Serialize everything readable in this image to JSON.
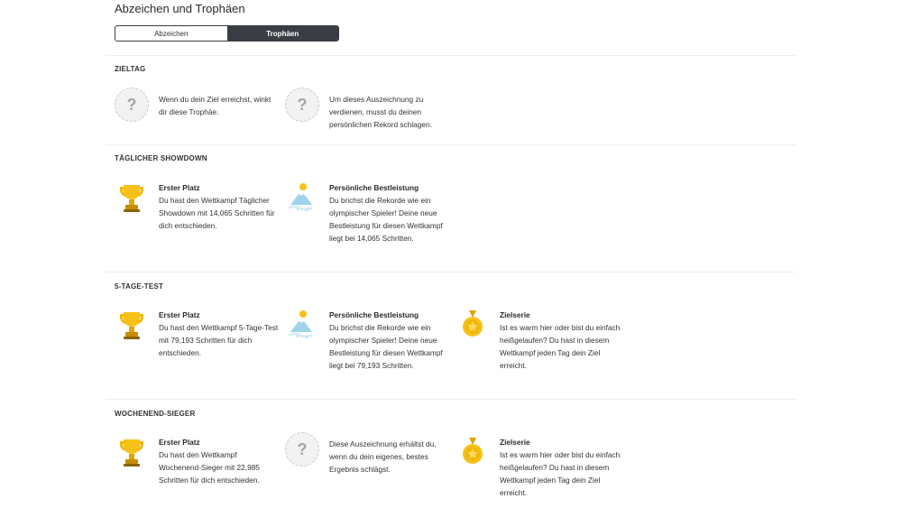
{
  "page": {
    "title": "Abzeichen und Trophäen"
  },
  "tabs": [
    {
      "label": "Abzeichen"
    },
    {
      "label": "Trophäen"
    }
  ],
  "sections": [
    {
      "title": "ZIELTAG",
      "items": [
        {
          "icon": "question-mark-icon",
          "title": "",
          "desc": "Wenn du dein Ziel erreichst, winkt dir diese Trophäe."
        },
        {
          "icon": "question-mark-icon",
          "title": "",
          "desc": "Um dieses Auszeichnung zu verdienen, musst du deinen persönlichen Rekord schlagen."
        }
      ]
    },
    {
      "title": "TÄGLICHER SHOWDOWN",
      "items": [
        {
          "icon": "trophy-icon",
          "title": "Erster Platz",
          "desc": "Du hast den Wettkampf Täglicher Showdown mit 14,065 Schritten für dich entschieden."
        },
        {
          "icon": "mountain-peak-icon",
          "title": "Persönliche Bestleistung",
          "desc": "Du brichst die Rekorde wie ein olympischer Spieler! Deine neue Bestleistung für diesen Wettkampf liegt bei 14,065 Schritten."
        }
      ]
    },
    {
      "title": "5-TAGE-TEST",
      "items": [
        {
          "icon": "trophy-icon",
          "title": "Erster Platz",
          "desc": "Du hast den Wettkampf 5-Tage-Test mit 79,193 Schritten für dich entschieden."
        },
        {
          "icon": "mountain-peak-icon",
          "title": "Persönliche Bestleistung",
          "desc": "Du brichst die Rekorde wie ein olympischer Spieler! Deine neue Bestleistung für diesen Wettkampf liegt bei 79,193 Schritten."
        },
        {
          "icon": "medal-icon",
          "title": "Zielserie",
          "desc": "Ist es warm hier oder bist du einfach heißgelaufen? Du hast in diesem Wettkampf jeden Tag dein Ziel erreicht."
        }
      ]
    },
    {
      "title": "WOCHENEND-SIEGER",
      "items": [
        {
          "icon": "trophy-icon",
          "title": "Erster Platz",
          "desc": "Du hast den Wettkampf Wochenend-Sieger mit 22,985 Schritten für dich entschieden."
        },
        {
          "icon": "question-mark-icon",
          "title": "",
          "desc": "Diese Auszeichnung erhältst du, wenn du dein eigenes, bestes Ergebnis schlägst."
        },
        {
          "icon": "medal-icon",
          "title": "Zielserie",
          "desc": "Ist es warm hier oder bist du einfach heißgelaufen? Du hast in diesem Wettkampf jeden Tag dein Ziel erreicht."
        }
      ]
    }
  ],
  "colors": {
    "tab_active_bg": "#3a3d44",
    "gold": "#f2b705",
    "divider": "#eeeeee"
  }
}
